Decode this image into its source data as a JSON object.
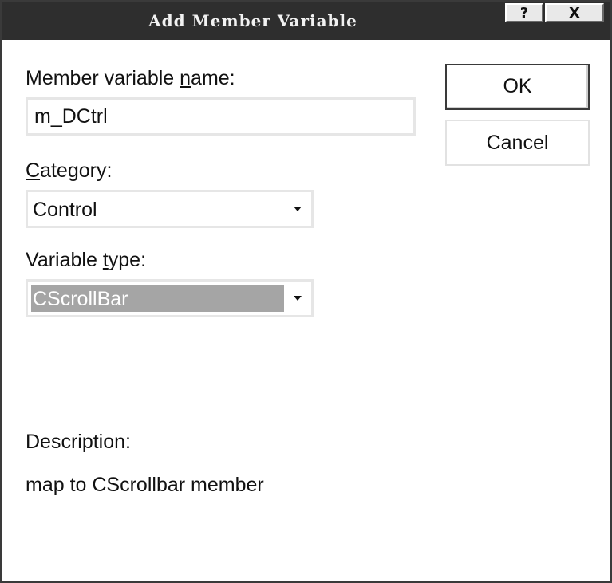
{
  "window": {
    "title": "Add Member Variable",
    "help_button": "?",
    "close_button": "X"
  },
  "form": {
    "name_label_pre": "Member variable ",
    "name_label_accel": "n",
    "name_label_post": "ame:",
    "name_value": "m_DCtrl",
    "category_label_accel": "C",
    "category_label_post": "ategory:",
    "category_value": "Control",
    "type_label_pre": "Variable ",
    "type_label_accel": "t",
    "type_label_post": "ype:",
    "type_value": "CScrollBar",
    "description_label": "Description:",
    "description_text": "map to CScrollbar member"
  },
  "buttons": {
    "ok": "OK",
    "cancel": "Cancel"
  }
}
